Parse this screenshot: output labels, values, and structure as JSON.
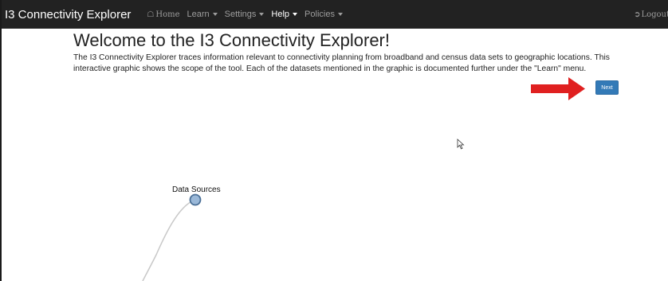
{
  "navbar": {
    "brand": "I3 Connectivity Explorer",
    "items": [
      {
        "icon": "home-icon",
        "label": "Home",
        "dropdown": false
      },
      {
        "label": "Learn",
        "dropdown": true
      },
      {
        "label": "Settings",
        "dropdown": true
      },
      {
        "label": "Help",
        "dropdown": true
      },
      {
        "label": "Policies",
        "dropdown": true
      }
    ],
    "logout_label": "Logout",
    "logout_icon": "logout-icon",
    "background_color": "#222222"
  },
  "main": {
    "title": "Welcome to the I3 Connectivity Explorer!",
    "description": "The I3 Connectivity Explorer traces information relevant to connectivity planning from broadband and census data sets to geographic locations. This interactive graphic shows the scope of the tool. Each of the datasets mentioned in the graphic is documented further under the \"Learn\" menu.",
    "next_label": "Next",
    "next_color": "#337ab7",
    "arrow_color": "#e02020"
  },
  "graph": {
    "node_label": "Data Sources",
    "node_fill": "#9ab8d8",
    "node_stroke": "#4a6f96"
  }
}
